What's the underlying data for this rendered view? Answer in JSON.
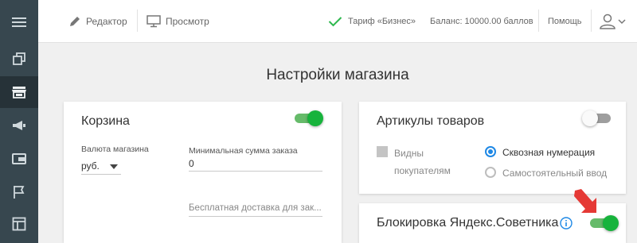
{
  "colors": {
    "accent_green": "#17b33c",
    "sidebar_bg": "#37474f",
    "radio_blue": "#1e88e5",
    "arrow_red": "#e53935"
  },
  "sidebar": {
    "items": [
      {
        "icon": "hamburger-menu-icon"
      },
      {
        "icon": "copy-pages-icon"
      },
      {
        "icon": "store-icon",
        "active": true
      },
      {
        "icon": "megaphone-icon"
      },
      {
        "icon": "wallet-icon"
      },
      {
        "icon": "flag-icon"
      },
      {
        "icon": "layout-icon"
      }
    ]
  },
  "topbar": {
    "editor_label": "Редактор",
    "preview_label": "Просмотр",
    "tariff_label": "Тариф «Бизнес»",
    "balance_label": "Баланс: 10000.00 баллов",
    "help_label": "Помощь"
  },
  "page": {
    "title": "Настройки магазина"
  },
  "cart_card": {
    "title": "Корзина",
    "toggle_on": true,
    "currency_label": "Валюта магазина",
    "currency_value": "руб.",
    "min_order_label": "Минимальная сумма заказа",
    "min_order_value": "0",
    "free_delivery_placeholder": "Бесплатная доставка для зак..."
  },
  "sku_card": {
    "title": "Артикулы товаров",
    "toggle_on": false,
    "visible_line1": "Видны",
    "visible_line2": "покупателям",
    "visible_checked": false,
    "radio_options": [
      {
        "label": "Сквозная нумерация",
        "checked": true
      },
      {
        "label": "Самостоятельный ввод",
        "checked": false
      }
    ]
  },
  "yandex_card": {
    "title": "Блокировка Яндекс.Советника",
    "toggle_on": true,
    "info_icon": "info-icon"
  }
}
